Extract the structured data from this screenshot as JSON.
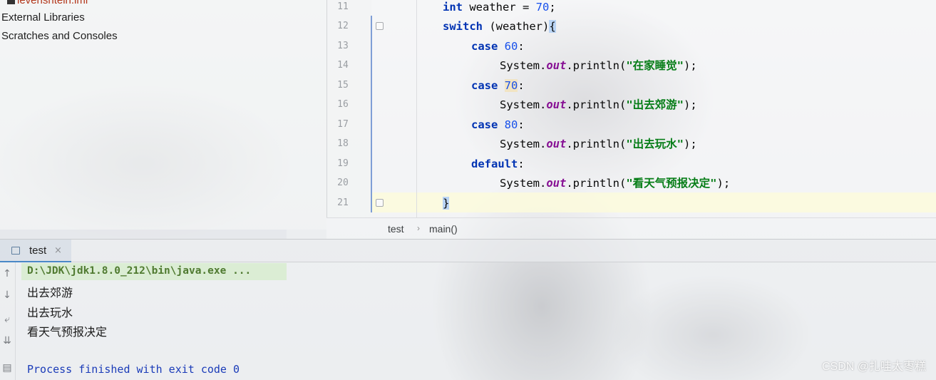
{
  "project_tree": {
    "items": [
      {
        "label": "levenshtein.iml",
        "kind": "file"
      },
      {
        "label": "External Libraries",
        "kind": "folder"
      },
      {
        "label": "Scratches and Consoles",
        "kind": "folder"
      }
    ]
  },
  "editor": {
    "line_numbers": [
      "11",
      "12",
      "13",
      "14",
      "15",
      "16",
      "17",
      "18",
      "19",
      "20",
      "21"
    ],
    "lines": {
      "l11": {
        "kw": "int",
        "var": " weather = ",
        "num": "70",
        "end": ";"
      },
      "l12": {
        "kw": "switch",
        "rest": " (weather)",
        "brace": "{"
      },
      "l13": {
        "kw": "case",
        "num": "60",
        "end": ":"
      },
      "l14": {
        "obj": "System.",
        "fld": "out",
        "call": ".println(",
        "str": "\"在家睡觉\"",
        "end": ");"
      },
      "l15": {
        "kw": "case",
        "num": "70",
        "end": ":"
      },
      "l16": {
        "obj": "System.",
        "fld": "out",
        "call": ".println(",
        "str": "\"出去郊游\"",
        "end": ");"
      },
      "l17": {
        "kw": "case",
        "num": "80",
        "end": ":"
      },
      "l18": {
        "obj": "System.",
        "fld": "out",
        "call": ".println(",
        "str": "\"出去玩水\"",
        "end": ");"
      },
      "l19": {
        "kw": "default",
        "end": ":"
      },
      "l20": {
        "obj": "System.",
        "fld": "out",
        "call": ".println(",
        "str": "\"看天气预报决定\"",
        "end": ");"
      },
      "l21": {
        "brace": "}"
      }
    }
  },
  "breadcrumb": {
    "items": [
      "test",
      "main()"
    ],
    "separator": "›"
  },
  "run_panel": {
    "tab_label": "test",
    "tab_close": "×",
    "command": "D:\\JDK\\jdk1.8.0_212\\bin\\java.exe ...",
    "output": [
      "出去郊游",
      "出去玩水",
      "看天气预报决定"
    ],
    "exit_message": "Process finished with exit code 0",
    "toolbar_icons": [
      "arrow-up-icon",
      "arrow-down-icon",
      "soft-wrap-icon",
      "scroll-to-end-icon",
      "print-icon"
    ]
  },
  "watermark": "CSDN @扎哇太枣糕",
  "colors": {
    "keyword": "#0033b3",
    "number": "#1750eb",
    "string": "#067d17",
    "field": "#871094",
    "current_line": "#fcfadc",
    "exit_text": "#1a3bb8"
  }
}
